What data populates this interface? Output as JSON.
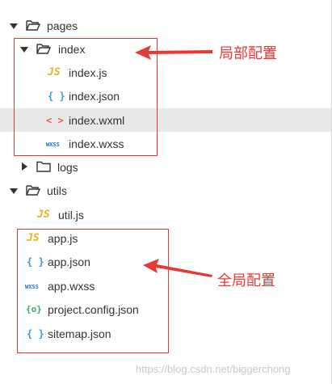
{
  "tree": {
    "pages": {
      "label": "pages"
    },
    "index": {
      "label": "index"
    },
    "index_js": {
      "label": "index.js",
      "icon": "js-file-icon",
      "glyph": "JS"
    },
    "index_json": {
      "label": "index.json",
      "icon": "json-file-icon",
      "glyph": "{ }"
    },
    "index_wxml": {
      "label": "index.wxml",
      "icon": "wxml-file-icon",
      "glyph": "< >"
    },
    "index_wxss": {
      "label": "index.wxss",
      "icon": "wxss-file-icon",
      "glyph": "WXSS"
    },
    "logs": {
      "label": "logs"
    },
    "utils": {
      "label": "utils"
    },
    "util_js": {
      "label": "util.js",
      "icon": "js-file-icon",
      "glyph": "JS"
    },
    "app_js": {
      "label": "app.js",
      "icon": "js-file-icon",
      "glyph": "JS"
    },
    "app_json": {
      "label": "app.json",
      "icon": "json-file-icon",
      "glyph": "{ }"
    },
    "app_wxss": {
      "label": "app.wxss",
      "icon": "wxss-file-icon",
      "glyph": "WXSS"
    },
    "project_config": {
      "label": "project.config.json",
      "icon": "config-file-icon",
      "glyph": "{o}"
    },
    "sitemap": {
      "label": "sitemap.json",
      "icon": "json-file-icon",
      "glyph": "{ }"
    }
  },
  "annotations": {
    "local": "局部配置",
    "global": "全局配置"
  },
  "colors": {
    "annotation": "#e53935",
    "selected_row": "#e8e8e8",
    "js": "#e6b41e",
    "json": "#3a9ad9",
    "wxml": "#e0663b",
    "wxss": "#1e74c6",
    "config": "#3aa86b"
  },
  "watermark": "https://blog.csdn.net/biggerchong"
}
